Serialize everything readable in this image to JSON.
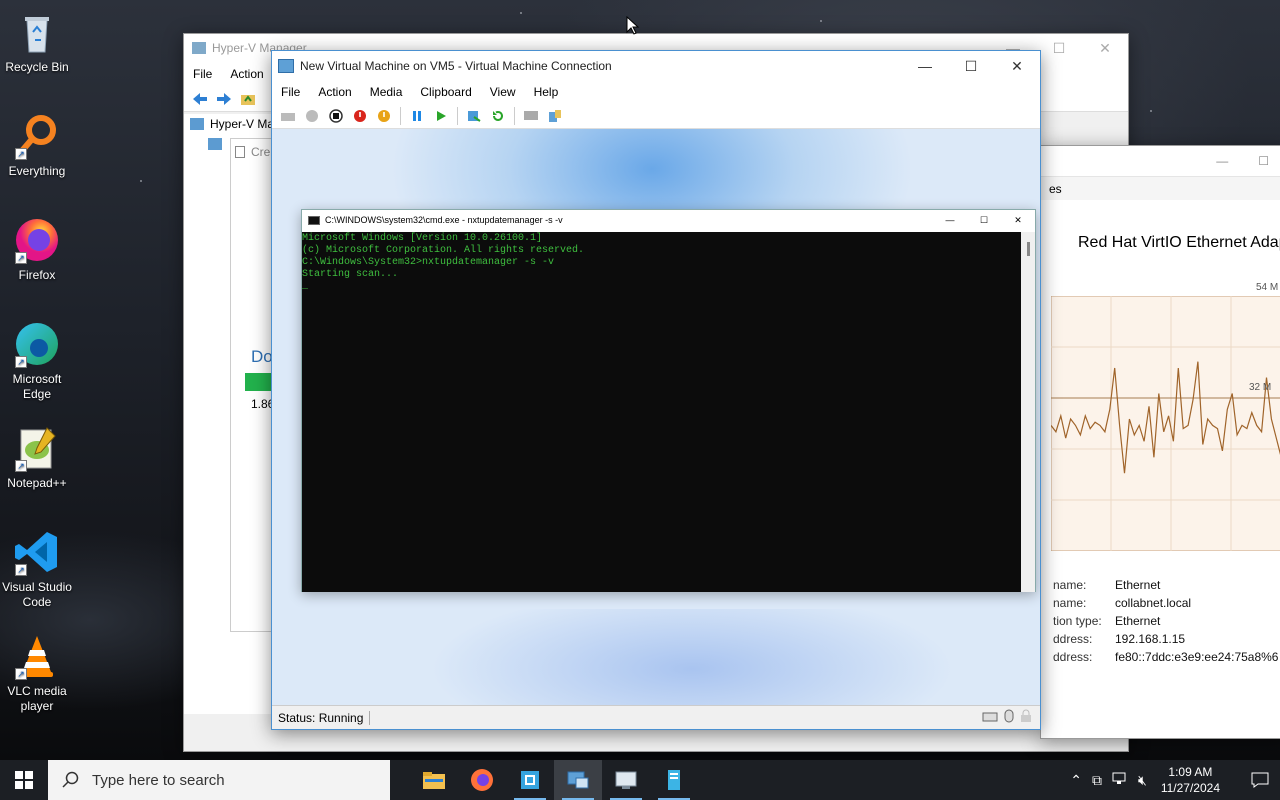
{
  "desktop": {
    "icons": [
      {
        "label": "Recycle Bin",
        "icon": "recycle-bin-icon"
      },
      {
        "label": "Everything",
        "icon": "everything-search-icon"
      },
      {
        "label": "Firefox",
        "icon": "firefox-icon"
      },
      {
        "label": "Microsoft Edge",
        "icon": "edge-icon"
      },
      {
        "label": "Notepad++",
        "icon": "notepad-plus-plus-icon"
      },
      {
        "label": "Visual Studio Code",
        "icon": "vscode-icon"
      },
      {
        "label": "VLC media player",
        "icon": "vlc-icon"
      }
    ]
  },
  "hyperv": {
    "title": "Hyper-V Manager",
    "menu": [
      "File",
      "Action"
    ],
    "tree_root": "Hyper-V Ma",
    "tree_child": "Cre",
    "download_text": "Do",
    "download_size": "1.86"
  },
  "taskmgr": {
    "tab_partial": "es",
    "adapter_title": "Red Hat VirtIO Ethernet Adap",
    "scale_top": "54 M",
    "scale_mid": "32 M",
    "details": [
      {
        "key": "name:",
        "value": "Ethernet"
      },
      {
        "key": "name:",
        "value": "collabnet.local"
      },
      {
        "key": "tion type:",
        "value": "Ethernet"
      },
      {
        "key": "ddress:",
        "value": "192.168.1.15"
      },
      {
        "key": "ddress:",
        "value": "fe80::7ddc:e3e9:ee24:75a8%6"
      }
    ],
    "series": [
      30,
      28,
      33,
      26,
      32,
      30,
      27,
      33,
      29,
      31,
      30,
      28,
      35,
      48,
      30,
      15,
      32,
      27,
      30,
      25,
      36,
      20,
      40,
      28,
      33,
      25,
      48,
      29,
      30,
      38,
      50,
      24,
      32,
      30,
      29,
      22,
      35,
      40,
      27,
      30,
      29,
      34,
      30,
      28,
      45,
      32,
      26,
      20,
      40,
      30
    ]
  },
  "vmconn": {
    "title": "New Virtual Machine on VM5 - Virtual Machine Connection",
    "menu": [
      "File",
      "Action",
      "Media",
      "Clipboard",
      "View",
      "Help"
    ],
    "status": "Status: Running",
    "accent": "#0078d4"
  },
  "cmd": {
    "title": "C:\\WINDOWS\\system32\\cmd.exe - nxtupdatemanager  -s -v",
    "lines": [
      "Microsoft Windows [Version 10.0.26100.1]",
      "(c) Microsoft Corporation. All rights reserved.",
      "",
      "C:\\Windows\\System32>nxtupdatemanager -s -v",
      "Starting scan...",
      "_"
    ]
  },
  "taskbar": {
    "search_placeholder": "Type here to search",
    "time": "1:09 AM",
    "date": "11/27/2024",
    "apps": [
      "file-explorer-icon",
      "firefox-icon",
      "hyperv-manager-icon",
      "vm-connection-icon",
      "remote-desktop-icon",
      "server-icon"
    ]
  }
}
